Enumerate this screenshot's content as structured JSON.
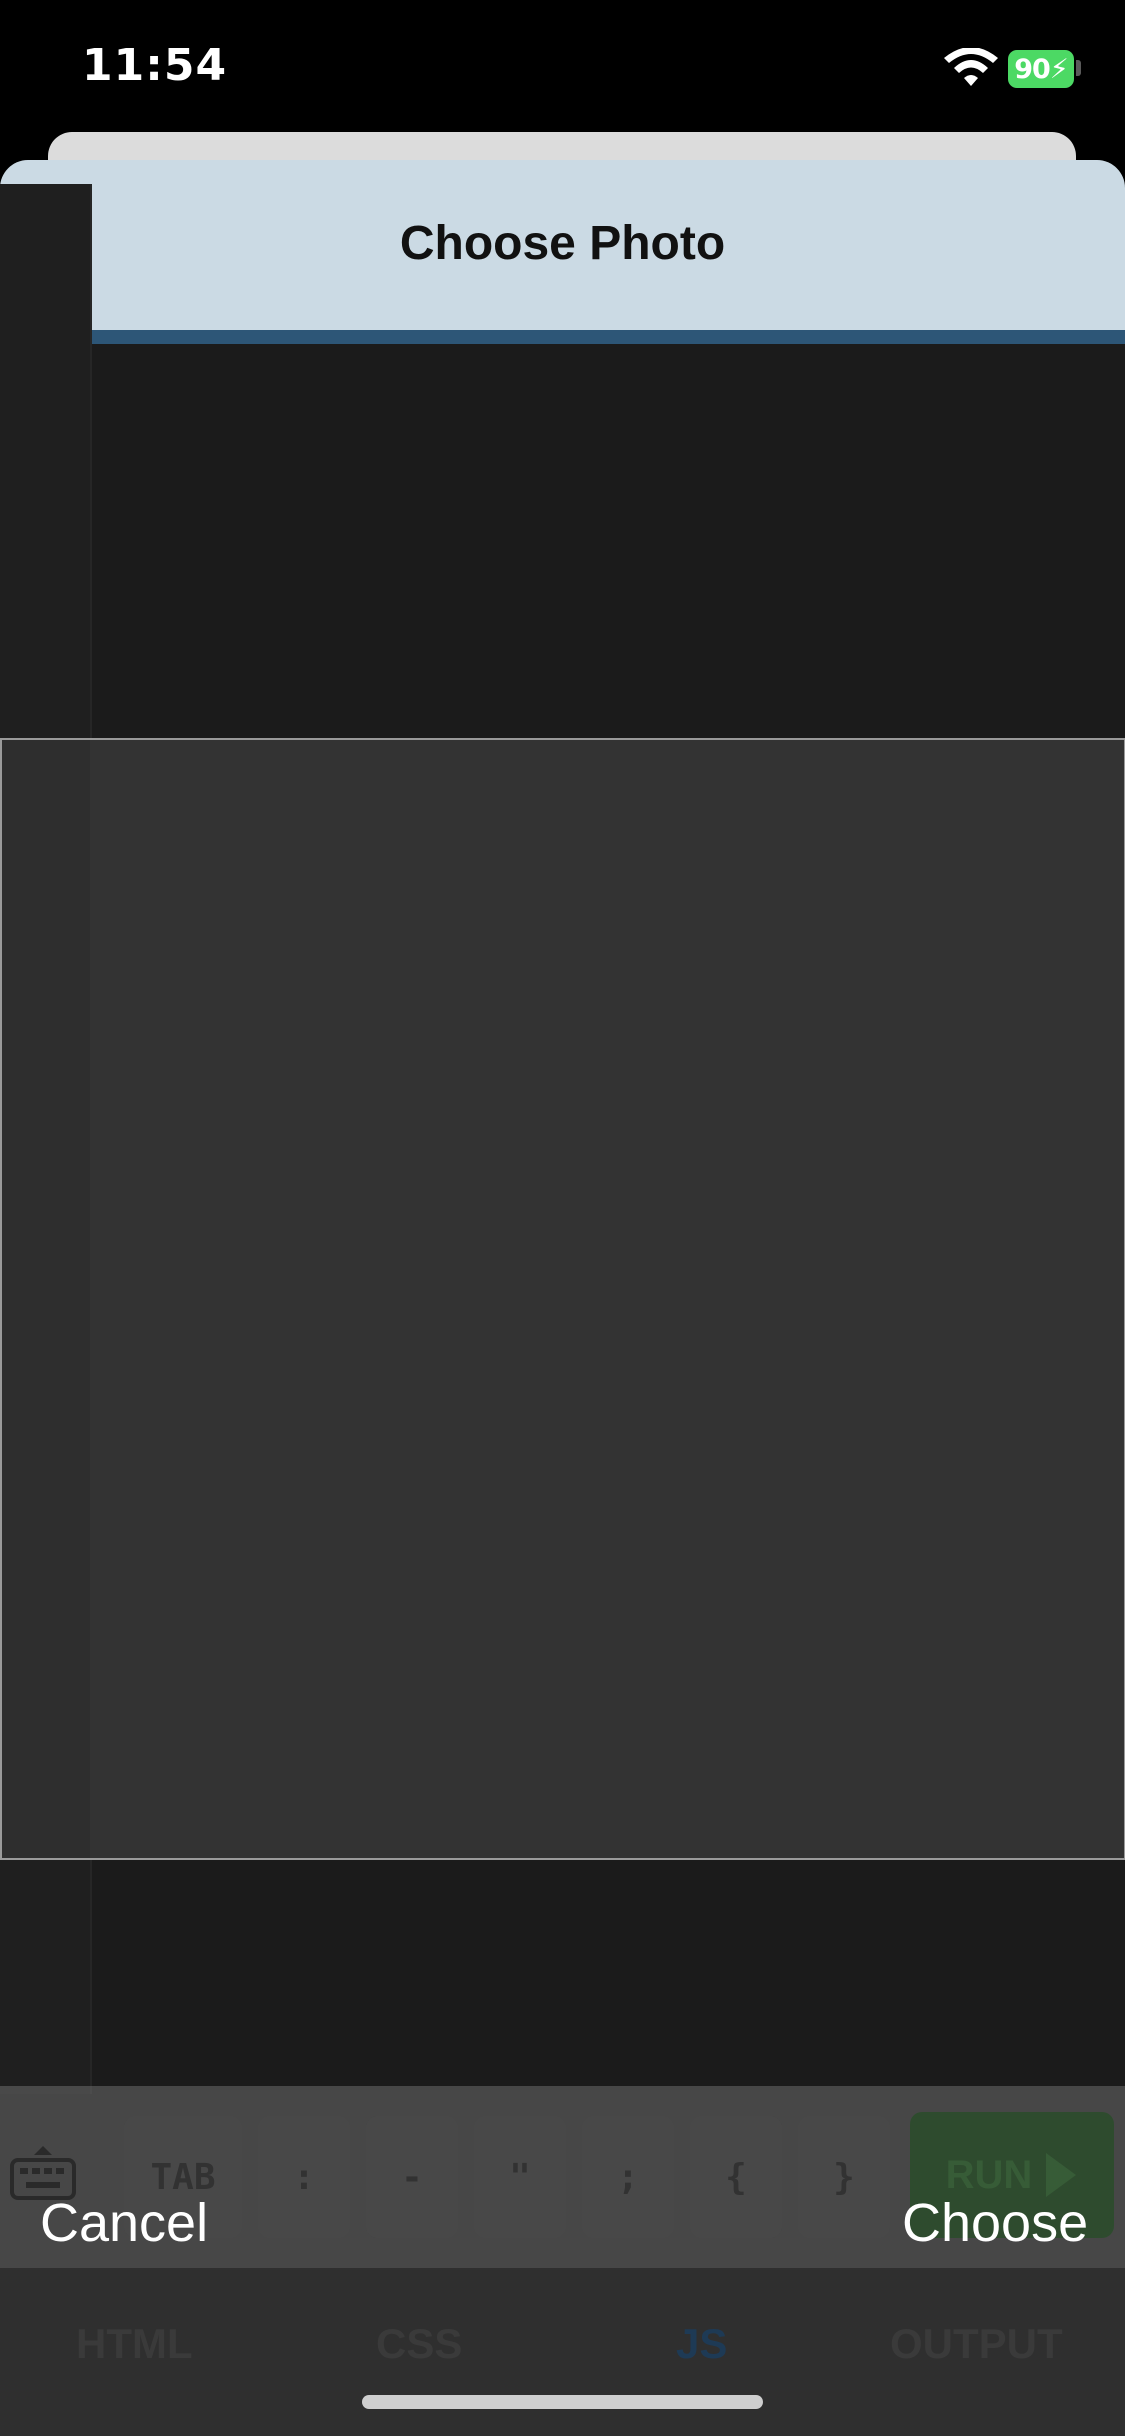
{
  "status_bar": {
    "time": "11:54",
    "battery_percent": "90",
    "battery_charging": true,
    "wifi": "wifi-icon"
  },
  "sheet": {
    "title": "Choose Photo"
  },
  "editor_keys": [
    "TAB",
    ":",
    "-",
    "\"",
    ";",
    "{",
    "}"
  ],
  "run_key": {
    "label": "RUN"
  },
  "tabs": [
    {
      "label": "HTML",
      "active": false
    },
    {
      "label": "CSS",
      "active": false
    },
    {
      "label": "JS",
      "active": true
    },
    {
      "label": "OUTPUT",
      "active": false
    }
  ],
  "actions": {
    "cancel": "Cancel",
    "choose": "Choose"
  },
  "colors": {
    "header": "#cbdae4",
    "header_line": "#2d5677",
    "battery": "#4cd964"
  }
}
